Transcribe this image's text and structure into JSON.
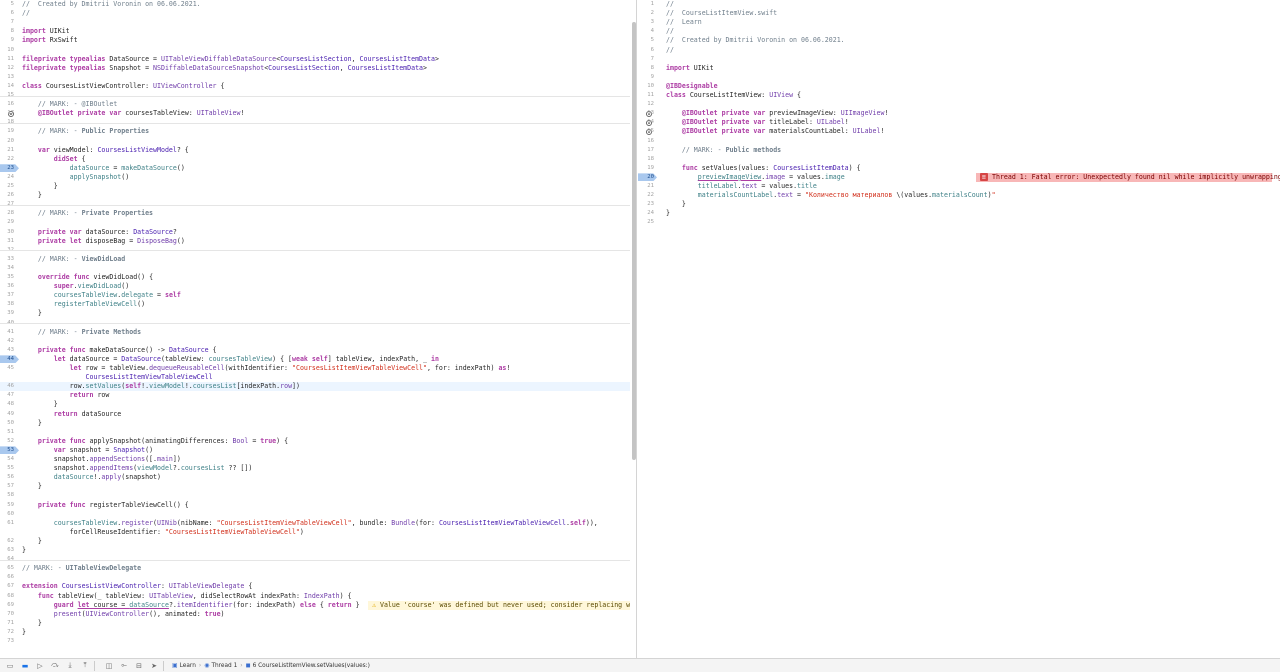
{
  "left_editor": {
    "file": "CoursesListViewController.swift",
    "lines": [
      {
        "n": "5",
        "html": "<span class='c'>//  Created by Dmitrii Voronin on 06.06.2021.</span>"
      },
      {
        "n": "6",
        "html": "<span class='c'>//</span>"
      },
      {
        "n": "7",
        "html": ""
      },
      {
        "n": "8",
        "html": "<span class='k'>import</span> UIKit"
      },
      {
        "n": "9",
        "html": "<span class='k'>import</span> RxSwift"
      },
      {
        "n": "10",
        "html": ""
      },
      {
        "n": "11",
        "html": "<span class='k'>fileprivate</span> <span class='k'>typealias</span> DataSource = <span class='t'>UITableViewDiffableDataSource</span>&lt;<span class='m'>CoursesListSection</span>, <span class='m'>CoursesListItemData</span>&gt;"
      },
      {
        "n": "12",
        "html": "<span class='k'>fileprivate</span> <span class='k'>typealias</span> Snapshot = <span class='t'>NSDiffableDataSourceSnapshot</span>&lt;<span class='m'>CoursesListSection</span>, <span class='m'>CoursesListItemData</span>&gt;"
      },
      {
        "n": "13",
        "html": ""
      },
      {
        "n": "14",
        "html": "<span class='k'>class</span> CoursesListViewController: <span class='t'>UIViewController</span> {"
      },
      {
        "n": "15",
        "html": "",
        "sep": true
      },
      {
        "n": "16",
        "html": "    <span class='c'>// MARK: - @IBOutlet</span>"
      },
      {
        "n": "17",
        "html": "    <span class='k'>@IBOutlet</span> <span class='k'>private</span> <span class='k'>var</span> coursesTableView: <span class='t'>UITableView</span>!",
        "outlet": true
      },
      {
        "n": "18",
        "html": "",
        "sep": true
      },
      {
        "n": "19",
        "html": "    <span class='c'>// MARK: - </span><span class='mk'>Public Properties</span>"
      },
      {
        "n": "20",
        "html": ""
      },
      {
        "n": "21",
        "html": "    <span class='k'>var</span> viewModel: <span class='m'>CoursesListViewModel</span>? {"
      },
      {
        "n": "22",
        "html": "        <span class='k'>didSet</span> {"
      },
      {
        "n": "23",
        "html": "            <span class='f'>dataSource</span> = <span class='f'>makeDataSource</span>()",
        "bp": true
      },
      {
        "n": "24",
        "html": "            <span class='f'>applySnapshot</span>()"
      },
      {
        "n": "25",
        "html": "        }"
      },
      {
        "n": "26",
        "html": "    }"
      },
      {
        "n": "27",
        "html": "",
        "sep": true
      },
      {
        "n": "28",
        "html": "    <span class='c'>// MARK: - </span><span class='mk'>Private Properties</span>"
      },
      {
        "n": "29",
        "html": ""
      },
      {
        "n": "30",
        "html": "    <span class='k'>private</span> <span class='k'>var</span> dataSource: <span class='m'>DataSource</span>?"
      },
      {
        "n": "31",
        "html": "    <span class='k'>private</span> <span class='k'>let</span> disposeBag = <span class='t'>DisposeBag</span>()"
      },
      {
        "n": "32",
        "html": "",
        "sep": true
      },
      {
        "n": "33",
        "html": "    <span class='c'>// MARK: - </span><span class='mk'>ViewDidLoad</span>"
      },
      {
        "n": "34",
        "html": ""
      },
      {
        "n": "35",
        "html": "    <span class='k'>override</span> <span class='k'>func</span> viewDidLoad() {"
      },
      {
        "n": "36",
        "html": "        <span class='k'>super</span>.<span class='f'>viewDidLoad</span>()"
      },
      {
        "n": "37",
        "html": "        <span class='f'>coursesTableView</span>.<span class='f'>delegate</span> = <span class='k'>self</span>"
      },
      {
        "n": "38",
        "html": "        <span class='f'>registerTableViewCell</span>()"
      },
      {
        "n": "39",
        "html": "    }"
      },
      {
        "n": "40",
        "html": "",
        "sep": true
      },
      {
        "n": "41",
        "html": "    <span class='c'>// MARK: - </span><span class='mk'>Private Methods</span>"
      },
      {
        "n": "42",
        "html": ""
      },
      {
        "n": "43",
        "html": "    <span class='k'>private</span> <span class='k'>func</span> makeDataSource() -&gt; <span class='m'>DataSource</span> {"
      },
      {
        "n": "44",
        "html": "        <span class='k'>let</span> dataSource = <span class='m'>DataSource</span>(tableView: <span class='f'>coursesTableView</span>) { [<span class='k'>weak</span> <span class='k'>self</span>] tableView, indexPath, _ <span class='k'>in</span>",
        "bp": true
      },
      {
        "n": "45",
        "html": "            <span class='k'>let</span> row = tableView.<span class='t'>dequeueReusableCell</span>(withIdentifier: <span class='s'>\"CoursesListItemViewTableViewCell\"</span>, for: indexPath) <span class='k'>as</span>!"
      },
      {
        "n": "",
        "html": "                <span class='m'>CoursesListItemViewTableViewCell</span>"
      },
      {
        "n": "46",
        "html": "            row.<span class='f'>setValues</span>(<span class='k'>self</span>!.<span class='f'>viewModel</span>!.<span class='f'>coursesList</span>[indexPath.<span class='t'>row</span>])",
        "current": true
      },
      {
        "n": "47",
        "html": "            <span class='k'>return</span> row"
      },
      {
        "n": "48",
        "html": "        }"
      },
      {
        "n": "49",
        "html": "        <span class='k'>return</span> dataSource"
      },
      {
        "n": "50",
        "html": "    }"
      },
      {
        "n": "51",
        "html": ""
      },
      {
        "n": "52",
        "html": "    <span class='k'>private</span> <span class='k'>func</span> applySnapshot(animatingDifferences: <span class='t'>Bool</span> = <span class='k'>true</span>) {"
      },
      {
        "n": "53",
        "html": "        <span class='k'>var</span> snapshot = <span class='m'>Snapshot</span>()",
        "bp": true
      },
      {
        "n": "54",
        "html": "        snapshot.<span class='t'>appendSections</span>([.<span class='t'>main</span>])"
      },
      {
        "n": "55",
        "html": "        snapshot.<span class='t'>appendItems</span>(<span class='f'>viewModel</span>?.<span class='f'>coursesList</span> ?? [])"
      },
      {
        "n": "56",
        "html": "        <span class='f'>dataSource</span>!.<span class='t'>apply</span>(snapshot)"
      },
      {
        "n": "57",
        "html": "    }"
      },
      {
        "n": "58",
        "html": ""
      },
      {
        "n": "59",
        "html": "    <span class='k'>private</span> <span class='k'>func</span> registerTableViewCell() {"
      },
      {
        "n": "60",
        "html": ""
      },
      {
        "n": "61",
        "html": "        <span class='f'>coursesTableView</span>.<span class='t'>register</span>(<span class='t'>UINib</span>(nibName: <span class='s'>\"CoursesListItemViewTableViewCell\"</span>, bundle: <span class='t'>Bundle</span>(for: <span class='m'>CoursesListItemViewTableViewCell</span>.<span class='k'>self</span>)),"
      },
      {
        "n": "",
        "html": "            forCellReuseIdentifier: <span class='s'>\"CoursesListItemViewTableViewCell\"</span>)"
      },
      {
        "n": "62",
        "html": "    }"
      },
      {
        "n": "63",
        "html": "}"
      },
      {
        "n": "64",
        "html": "",
        "sep": true
      },
      {
        "n": "65",
        "html": "<span class='c'>// MARK: - </span><span class='mk'>UITableViewDelegate</span>"
      },
      {
        "n": "66",
        "html": ""
      },
      {
        "n": "67",
        "html": "<span class='k'>extension</span> <span class='m'>CoursesListViewController</span>: <span class='t'>UITableViewDelegate</span> {"
      },
      {
        "n": "68",
        "html": "    <span class='k'>func</span> tableView(_ tableView: <span class='t'>UITableView</span>, didSelectRowAt indexPath: <span class='t'>IndexPath</span>) {"
      },
      {
        "n": "69",
        "html": "        <span class='k'>guard</span> <span class='k ul'>let</span><span class='ul'> course = </span><span class='f ul'>dataSource</span>?.<span class='t'>itemIdentifier</span>(for: indexPath) <span class='k'>else</span> { <span class='k'>return</span> }",
        "warning": true
      },
      {
        "n": "70",
        "html": "        <span class='t'>present</span>(<span class='t'>UIViewController</span>(), animated: <span class='k'>true</span>)"
      },
      {
        "n": "71",
        "html": "    }"
      },
      {
        "n": "72",
        "html": "}"
      },
      {
        "n": "73",
        "html": ""
      }
    ],
    "warning_text": "Value 'course' was defined but never used; consider replacing with boolean test"
  },
  "right_editor": {
    "file": "CourseListItemView.swift",
    "lines": [
      {
        "n": "1",
        "html": "<span class='c'>//</span>"
      },
      {
        "n": "2",
        "html": "<span class='c'>//  CourseListItemView.swift</span>"
      },
      {
        "n": "3",
        "html": "<span class='c'>//  Learn</span>"
      },
      {
        "n": "4",
        "html": "<span class='c'>//</span>"
      },
      {
        "n": "5",
        "html": "<span class='c'>//  Created by Dmitrii Voronin on 06.06.2021.</span>"
      },
      {
        "n": "6",
        "html": "<span class='c'>//</span>"
      },
      {
        "n": "7",
        "html": ""
      },
      {
        "n": "8",
        "html": "<span class='k'>import</span> UIKit"
      },
      {
        "n": "9",
        "html": ""
      },
      {
        "n": "10",
        "html": "<span class='k'>@IBDesignable</span>"
      },
      {
        "n": "11",
        "html": "<span class='k'>class</span> CourseListItemView: <span class='t'>UIView</span> {"
      },
      {
        "n": "12",
        "html": ""
      },
      {
        "n": "13",
        "html": "    <span class='k'>@IBOutlet</span> <span class='k'>private</span> <span class='k'>var</span> previewImageView: <span class='t'>UIImageView</span>!",
        "outlet": true
      },
      {
        "n": "14",
        "html": "    <span class='k'>@IBOutlet</span> <span class='k'>private</span> <span class='k'>var</span> titleLabel: <span class='t'>UILabel</span>!",
        "outlet": true
      },
      {
        "n": "15",
        "html": "    <span class='k'>@IBOutlet</span> <span class='k'>private</span> <span class='k'>var</span> materialsCountLabel: <span class='t'>UILabel</span>!",
        "outlet": true
      },
      {
        "n": "16",
        "html": ""
      },
      {
        "n": "17",
        "html": "    <span class='c'>// MARK: - </span><span class='mk'>Public methods</span>"
      },
      {
        "n": "18",
        "html": ""
      },
      {
        "n": "19",
        "html": "    <span class='k'>func</span> setValues(values: <span class='m'>CoursesListItemData</span>) {"
      },
      {
        "n": "20",
        "html": "        <span class='f ul'>previewImageView</span>.<span class='t'>image</span> = values.<span class='f'>image</span>",
        "bp": true,
        "error": true
      },
      {
        "n": "21",
        "html": "        <span class='f'>titleLabel</span>.<span class='t'>text</span> = values.<span class='f'>title</span>"
      },
      {
        "n": "22",
        "html": "        <span class='f'>materialsCountLabel</span>.<span class='t'>text</span> = <span class='s'>\"Количество материалов </span>\\(values.<span class='f'>materialsCount</span>)<span class='s'>\"</span>"
      },
      {
        "n": "23",
        "html": "    }"
      },
      {
        "n": "24",
        "html": "}"
      },
      {
        "n": "25",
        "html": ""
      }
    ],
    "error_text": "Thread 1: Fatal error: Unexpectedly found nil while implicitly unwrapping an Optional value"
  },
  "status_bar": {
    "crumbs": [
      "Learn",
      "Thread 1",
      "6 CourseListItemView.setValues(values:)"
    ],
    "icons": [
      "console-toggle-icon",
      "breakpoints-toggle-icon",
      "continue-icon",
      "step-over-icon",
      "step-into-icon",
      "step-out-icon",
      "view-debugger-icon",
      "memory-graph-icon",
      "environment-overrides-icon",
      "location-icon"
    ]
  },
  "colors": {
    "keyword": "#ad3da4",
    "type": "#703daa",
    "function": "#3e8087",
    "string": "#d12f1b",
    "comment": "#707f8c",
    "breakpoint": "#a9c8ee",
    "error_bg": "#f8b7b7",
    "warning_bg": "#fff7d9"
  }
}
